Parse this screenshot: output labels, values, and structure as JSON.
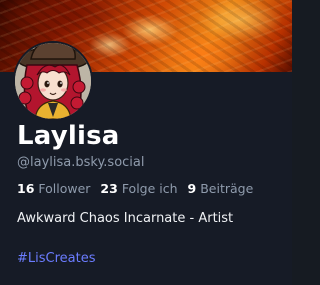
{
  "profile": {
    "display_name": "Laylisa",
    "handle": "@laylisa.bsky.social",
    "followers_count": "16",
    "followers_label": "Follower",
    "following_count": "23",
    "following_label": "Folge ich",
    "posts_count": "9",
    "posts_label": "Beiträge",
    "bio": "Awkward Chaos Incarnate - Artist",
    "hashtag": "#LisCreates"
  },
  "colors": {
    "background": "#161b26",
    "name_text": "#ffffff",
    "muted_text": "#8f9bac",
    "link": "#6b7cff"
  },
  "icons": {
    "avatar": "cartoon-avatar-red-hair-hat"
  }
}
